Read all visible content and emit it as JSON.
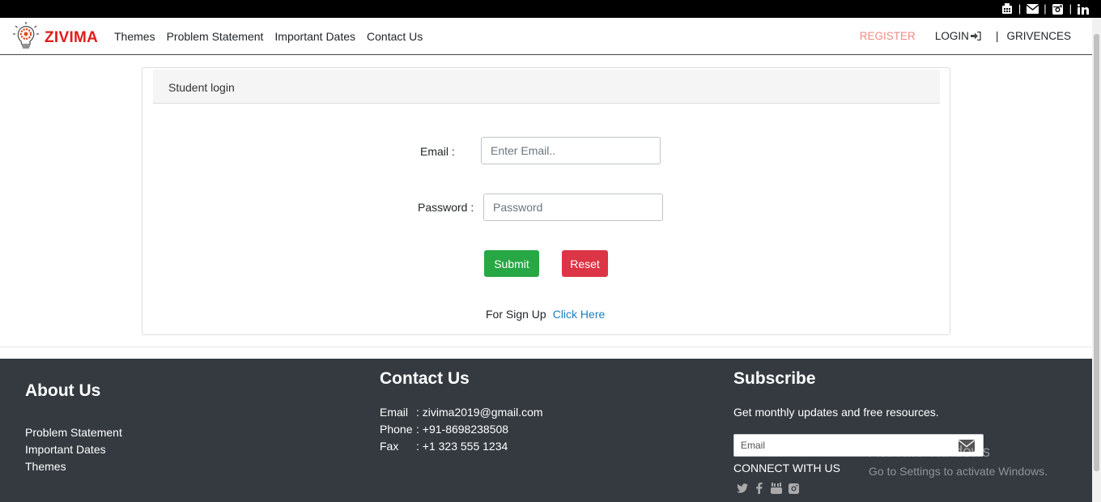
{
  "brand": {
    "name": "ZIVIMA",
    "logo_icon": "gear-bulb-logo"
  },
  "topbar": {
    "icons": [
      "fax-icon",
      "mail-icon",
      "instagram-icon",
      "linkedin-icon"
    ],
    "separator": "|"
  },
  "nav": {
    "links": [
      "Themes",
      "Problem Statement",
      "Important Dates",
      "Contact Us"
    ],
    "register": "REGISTER",
    "login": "LOGIN",
    "separator": "|",
    "grievances": "GRIVENCES"
  },
  "login_card": {
    "title": "Student login",
    "email_label": "Email :",
    "email_placeholder": "Enter Email..",
    "password_label": "Password :",
    "password_placeholder": "Password",
    "submit_label": "Submit",
    "reset_label": "Reset",
    "signup_text": "For Sign Up",
    "signup_link": "Click Here"
  },
  "footer": {
    "about": {
      "title": "About Us",
      "links": [
        "Problem Statement",
        "Important Dates",
        "Themes"
      ]
    },
    "contact": {
      "title": "Contact Us",
      "rows": [
        {
          "key": "Email",
          "value": ": zivima2019@gmail.com"
        },
        {
          "key": "Phone",
          "value": ": +91-8698238508"
        },
        {
          "key": "Fax",
          "value": ": +1 323 555 1234"
        }
      ]
    },
    "subscribe": {
      "title": "Subscribe",
      "text": "Get monthly updates and free resources.",
      "input_placeholder": "Email",
      "connect": "CONNECT WITH US",
      "social_icons": [
        "twitter-icon",
        "facebook-icon",
        "youtube-icon",
        "instagram-icon"
      ]
    }
  },
  "watermark": {
    "line1": "Activate Windows",
    "line2": "Go to Settings to activate Windows."
  },
  "colors": {
    "brand_red": "#e21b1b",
    "register": "#f08a80",
    "submit": "#28a745",
    "reset": "#dc3545",
    "footer_bg": "#343a40",
    "link": "#1a7fc1"
  }
}
